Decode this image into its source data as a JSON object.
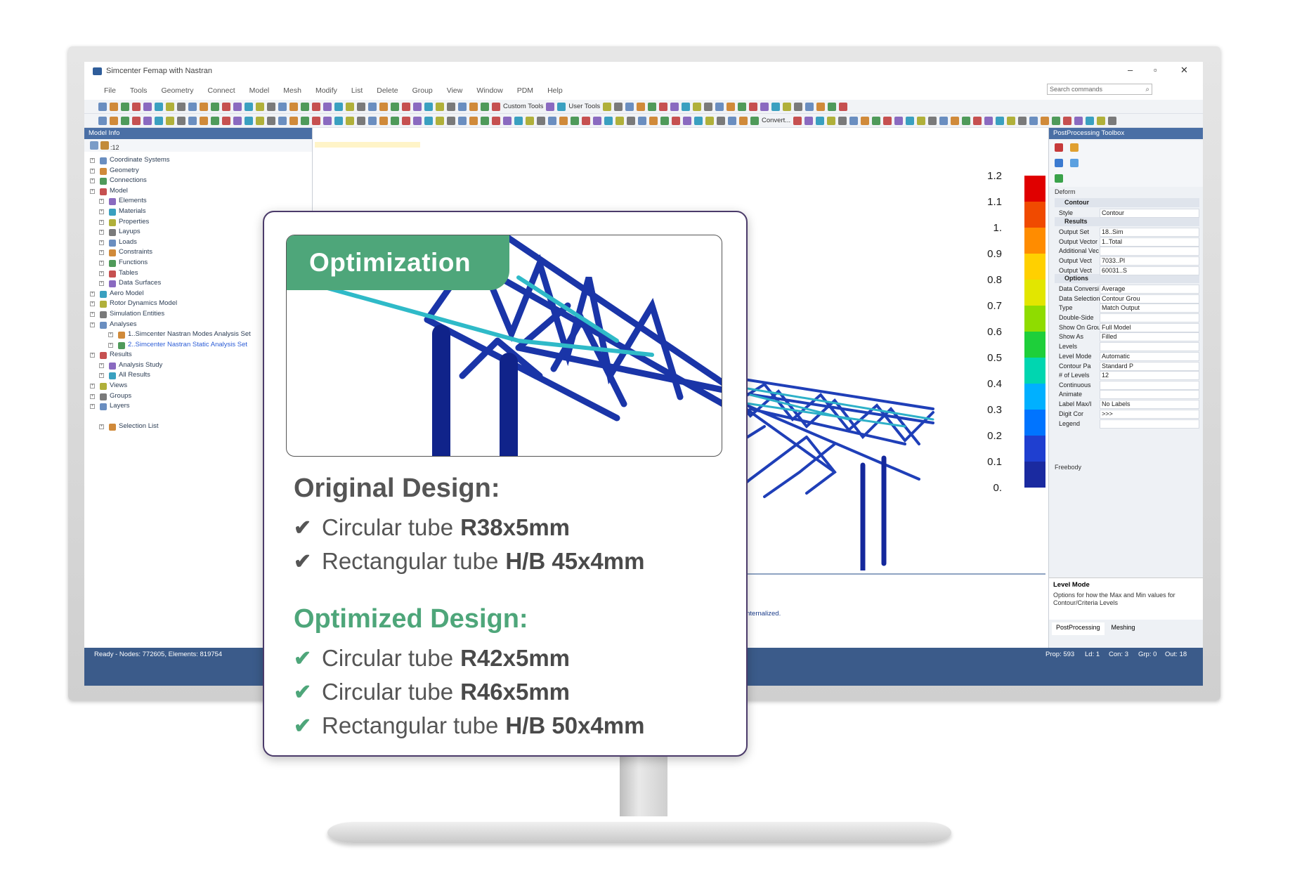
{
  "app": {
    "title": "Simcenter Femap with Nastran",
    "menu": [
      "File",
      "Tools",
      "Geometry",
      "Connect",
      "Model",
      "Mesh",
      "Modify",
      "List",
      "Delete",
      "Group",
      "View",
      "Window",
      "PDM",
      "Help"
    ],
    "search_placeholder": "Search commands",
    "toolbar_labels": {
      "custom_tools": "Custom Tools",
      "user_tools": "User Tools",
      "convert": "Convert..."
    }
  },
  "model_info": {
    "header": "Model Info",
    "filter_text": ":12",
    "tree": [
      {
        "label": "Coordinate Systems",
        "level": 0,
        "icon": "coordinate-icon"
      },
      {
        "label": "Geometry",
        "level": 0,
        "icon": "geometry-icon"
      },
      {
        "label": "Connections",
        "level": 0,
        "icon": "connections-icon"
      },
      {
        "label": "Model",
        "level": 0,
        "icon": "model-icon"
      },
      {
        "label": "Elements",
        "level": 1,
        "icon": "elements-icon"
      },
      {
        "label": "Materials",
        "level": 1,
        "icon": "materials-icon"
      },
      {
        "label": "Properties",
        "level": 1,
        "icon": "properties-icon"
      },
      {
        "label": "Layups",
        "level": 1,
        "icon": "layups-icon"
      },
      {
        "label": "Loads",
        "level": 1,
        "icon": "loads-icon"
      },
      {
        "label": "Constraints",
        "level": 1,
        "icon": "constraints-icon"
      },
      {
        "label": "Functions",
        "level": 1,
        "icon": "functions-icon"
      },
      {
        "label": "Tables",
        "level": 1,
        "icon": "tables-icon"
      },
      {
        "label": "Data Surfaces",
        "level": 1,
        "icon": "data-surfaces-icon"
      },
      {
        "label": "Aero Model",
        "level": 0,
        "icon": "aero-icon"
      },
      {
        "label": "Rotor Dynamics Model",
        "level": 0,
        "icon": "rotor-icon"
      },
      {
        "label": "Simulation Entities",
        "level": 0,
        "icon": "simulation-icon"
      },
      {
        "label": "Analyses",
        "level": 0,
        "icon": "analyses-icon"
      },
      {
        "label": "1..Simcenter Nastran Modes Analysis Set",
        "level": 2,
        "icon": "analysis-set-icon"
      },
      {
        "label": "2..Simcenter Nastran Static Analysis Set",
        "level": 2,
        "icon": "analysis-set-icon",
        "active": true
      },
      {
        "label": "Results",
        "level": 0,
        "icon": "results-icon"
      },
      {
        "label": "Analysis Study",
        "level": 1,
        "icon": "study-icon"
      },
      {
        "label": "All Results",
        "level": 1,
        "icon": "all-results-icon"
      },
      {
        "label": "Views",
        "level": 0,
        "icon": "views-icon"
      },
      {
        "label": "Groups",
        "level": 0,
        "icon": "groups-icon"
      },
      {
        "label": "Layers",
        "level": 0,
        "icon": "layers-icon"
      },
      {
        "label": "Selection List",
        "level": 1,
        "icon": "selection-icon"
      }
    ]
  },
  "toolbox": {
    "header": "PostProcessing Toolbox",
    "deform": "Deform",
    "contour": "Contour",
    "results": "Results",
    "options": "Options",
    "rows": [
      {
        "k": "Style",
        "v": "Contour"
      },
      {
        "k": "Output Set",
        "v": "18..Sim"
      },
      {
        "k": "Output Vector",
        "v": "1..Total"
      },
      {
        "k": "Additional Vec",
        "v": ""
      },
      {
        "k": "Output Vect",
        "v": "7033..Pl"
      },
      {
        "k": "Output Vect",
        "v": "60031..S"
      },
      {
        "k": "Data Conversi",
        "v": "Average"
      },
      {
        "k": "Data Selection",
        "v": "Contour Grou"
      },
      {
        "k": "Type",
        "v": "Match Output"
      },
      {
        "k": "Double-Side",
        "v": ""
      },
      {
        "k": "Show On Grou",
        "v": "Full Model"
      },
      {
        "k": "Show As",
        "v": "Filled"
      },
      {
        "k": "Levels",
        "v": ""
      },
      {
        "k": "Level Mode",
        "v": "Automatic"
      },
      {
        "k": "Contour Pa",
        "v": "Standard P"
      },
      {
        "k": "# of Levels",
        "v": "12"
      },
      {
        "k": "Continuous",
        "v": ""
      },
      {
        "k": "Animate",
        "v": ""
      },
      {
        "k": "Label Max/I",
        "v": "No Labels"
      },
      {
        "k": "Digit Cor",
        "v": ">>>"
      },
      {
        "k": "Legend",
        "v": ""
      }
    ],
    "freebody": "Freebody",
    "help_title": "Level Mode",
    "help_text": "Options for how the Max and Min values for Contour/Criteria Levels",
    "tabs": [
      "PostProcessing",
      "Meshing"
    ]
  },
  "message": "internalized.",
  "status": {
    "left": "Ready - Nodes: 772605,  Elements: 819754",
    "prop": "Prop: 593",
    "ld": "Ld: 1",
    "con": "Con: 3",
    "grp": "Grp: 0",
    "out": "Out: 18"
  },
  "legend": {
    "labels": [
      "1.2",
      "1.1",
      "1.",
      "0.9",
      "0.8",
      "0.7",
      "0.6",
      "0.5",
      "0.4",
      "0.3",
      "0.2",
      "0.1",
      "0."
    ],
    "colors": [
      "#e00000",
      "#f04a00",
      "#ff8c00",
      "#ffd000",
      "#e2e600",
      "#8fdc00",
      "#1ecf3a",
      "#00d6b0",
      "#00b0ff",
      "#0074ff",
      "#1f3fd0",
      "#1a2aa0",
      "#13157a"
    ]
  },
  "card": {
    "badge": "Optimization",
    "original_title": "Original Design:",
    "original": [
      {
        "text": "Circular tube",
        "bold": "R38x5mm"
      },
      {
        "text": "Rectangular tube",
        "bold": "H/B 45x4mm"
      }
    ],
    "optimized_title": "Optimized Design:",
    "optimized": [
      {
        "text": "Circular tube",
        "bold": "R42x5mm"
      },
      {
        "text": "Circular tube",
        "bold": "R46x5mm"
      },
      {
        "text": "Rectangular tube",
        "bold": "H/B 50x4mm"
      }
    ],
    "colors": {
      "accent": "#4ea67a",
      "original_title": "#555555",
      "border": "#4b3b6a"
    }
  }
}
